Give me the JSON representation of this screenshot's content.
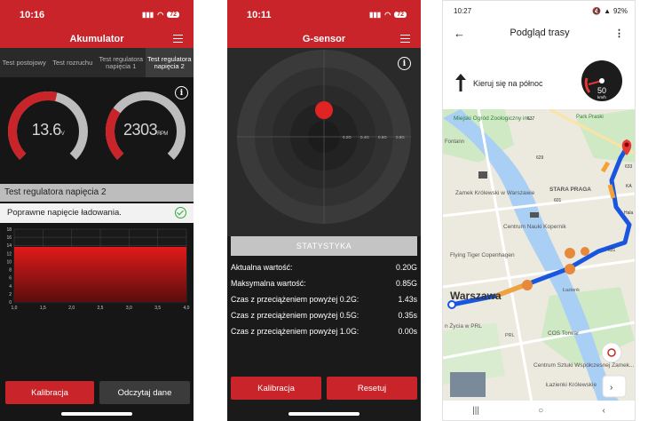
{
  "phone1": {
    "time": "10:16",
    "battery": "72",
    "title": "Akumulator",
    "tabs": [
      {
        "label": "Test postojowy"
      },
      {
        "label": "Test rozruchu"
      },
      {
        "label": "Test regulatora napięcia 1"
      },
      {
        "label": "Test regulatora napięcia 2"
      }
    ],
    "gauge_voltage": {
      "value": "13.6",
      "unit": "V",
      "fill": 0.55
    },
    "gauge_rpm": {
      "value": "2303",
      "unit": "RPM",
      "fill": 0.3
    },
    "section_title": "Test regulatora napięcia 2",
    "status_text": "Poprawne napięcie ładowania.",
    "chart_data": {
      "type": "area",
      "x_ticks": [
        "1,0",
        "1,5",
        "2,0",
        "2,5",
        "3,0",
        "3,5",
        "4,0"
      ],
      "y_ticks": [
        "0",
        "2",
        "4",
        "6",
        "8",
        "10",
        "12",
        "14",
        "16",
        "18"
      ],
      "xlim": [
        1.0,
        4.0
      ],
      "ylim": [
        0,
        18
      ],
      "values": [
        13.6,
        13.6
      ],
      "grid": true
    },
    "btn_calibration": "Kalibracja",
    "btn_read": "Odczytaj dane"
  },
  "phone2": {
    "time": "10:11",
    "battery": "72",
    "title": "G-sensor",
    "radar_labels": [
      "0.2G",
      "0.4G",
      "0.6G",
      "0.8G"
    ],
    "stats_header": "STATYSTYKA",
    "stats": [
      {
        "label": "Aktualna wartość:",
        "value": "0.20G"
      },
      {
        "label": "Maksymalna wartość:",
        "value": "0.85G"
      },
      {
        "label": "Czas z przeciążeniem powyżej 0.2G:",
        "value": "1.43s"
      },
      {
        "label": "Czas z przeciążeniem powyżej 0.5G:",
        "value": "0.35s"
      },
      {
        "label": "Czas z przeciążeniem powyżej 1.0G:",
        "value": "0.00s"
      }
    ],
    "btn_calibration": "Kalibracja",
    "btn_reset": "Resetuj"
  },
  "phone3": {
    "time": "10:27",
    "battery": "92%",
    "title": "Podgląd trasy",
    "direction": "Kieruj się na północ",
    "speed": "50",
    "speed_unit": "km/h",
    "map_labels": {
      "zoo": "Miejski Ogród Zoologiczny im...",
      "park": "Park Praski",
      "fontann": "Fontann",
      "castle": "Zamek Królewski w Warszawie",
      "praga": "STARA PRAGA",
      "kopernik": "Centrum Nauki Kopernik",
      "flying_tiger": "Flying Tiger Copenhagen",
      "city": "Warszawa",
      "zycia": "n Życia w PRL",
      "cos": "COS Torwar",
      "sztuki": "Centrum Sztuki Współczesnej Zamek...",
      "lazienki": "Łazienki Królewskie",
      "prl": "PRL",
      "lazienk2": "Łazienk",
      "road_637": "637",
      "road_629": "629",
      "road_601": "601",
      "road_631": "631",
      "road_633": "633",
      "road_ka": "KA",
      "road_hala": "Hala"
    }
  }
}
